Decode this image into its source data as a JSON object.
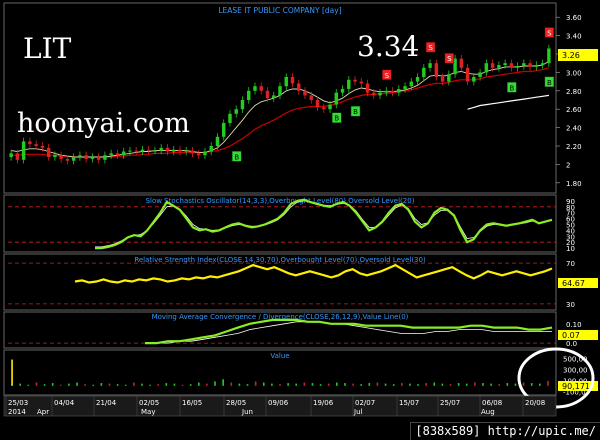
{
  "overlay": {
    "ticker": "LIT",
    "price": "3.34",
    "watermark": "hoonyai.com"
  },
  "footer": "[838x589] http://upic.me/",
  "chart_data": [
    {
      "type": "candlestick",
      "title": "LEASE IT PUBLIC COMPANY [day]",
      "ylim": [
        1.7,
        3.7
      ],
      "yticks": [
        1.8,
        2.0,
        2.2,
        2.4,
        2.6,
        2.8,
        3.0,
        3.2,
        3.4,
        3.6
      ],
      "ytick_labels": [
        "1.80",
        "2",
        "2.20",
        "2.40",
        "2.60",
        "2.80",
        "3.00",
        "3.20",
        "3.40",
        "3.60"
      ],
      "last_price_label": "3.26",
      "close": [
        2.12,
        2.05,
        2.25,
        2.22,
        2.2,
        2.18,
        2.08,
        2.1,
        2.06,
        2.04,
        2.08,
        2.1,
        2.06,
        2.08,
        2.05,
        2.1,
        2.12,
        2.1,
        2.14,
        2.15,
        2.14,
        2.16,
        2.15,
        2.15,
        2.18,
        2.14,
        2.16,
        2.14,
        2.15,
        2.12,
        2.1,
        2.14,
        2.2,
        2.3,
        2.45,
        2.55,
        2.6,
        2.7,
        2.8,
        2.85,
        2.8,
        2.72,
        2.75,
        2.85,
        2.95,
        2.88,
        2.8,
        2.75,
        2.7,
        2.62,
        2.6,
        2.65,
        2.78,
        2.82,
        2.92,
        2.9,
        2.88,
        2.78,
        2.75,
        2.78,
        2.8,
        2.78,
        2.82,
        2.85,
        2.9,
        2.95,
        3.05,
        3.1,
        2.95,
        2.9,
        2.98,
        3.15,
        3.05,
        2.9,
        2.95,
        3.0,
        3.1,
        3.05,
        3.08,
        3.1,
        3.05,
        3.07,
        3.1,
        3.06,
        3.08,
        3.1,
        3.26
      ],
      "buy_signals": [
        36,
        52,
        55,
        80,
        100
      ],
      "sell_signals": [
        60,
        67,
        70,
        88
      ],
      "sma_fast": [
        2.15,
        2.14,
        2.16,
        2.17,
        2.17,
        2.16,
        2.14,
        2.12,
        2.1,
        2.09,
        2.08,
        2.08,
        2.08,
        2.08,
        2.08,
        2.08,
        2.09,
        2.1,
        2.11,
        2.12,
        2.13,
        2.14,
        2.14,
        2.15,
        2.15,
        2.15,
        2.15,
        2.15,
        2.15,
        2.14,
        2.13,
        2.13,
        2.15,
        2.18,
        2.24,
        2.32,
        2.4,
        2.48,
        2.57,
        2.64,
        2.68,
        2.7,
        2.72,
        2.75,
        2.8,
        2.82,
        2.82,
        2.8,
        2.77,
        2.73,
        2.69,
        2.67,
        2.69,
        2.72,
        2.77,
        2.81,
        2.83,
        2.82,
        2.8,
        2.79,
        2.79,
        2.79,
        2.8,
        2.81,
        2.83,
        2.86,
        2.91,
        2.96,
        2.97,
        2.96,
        2.97,
        3.0,
        3.01,
        2.99,
        2.98,
        2.98,
        3.01,
        3.03,
        3.04,
        3.06,
        3.06,
        3.06,
        3.07,
        3.07,
        3.07,
        3.08,
        3.12
      ],
      "sma_slow": [
        2.1,
        2.1,
        2.11,
        2.11,
        2.11,
        2.11,
        2.1,
        2.1,
        2.09,
        2.09,
        2.08,
        2.08,
        2.08,
        2.08,
        2.08,
        2.08,
        2.08,
        2.09,
        2.09,
        2.1,
        2.1,
        2.11,
        2.11,
        2.12,
        2.12,
        2.12,
        2.13,
        2.13,
        2.13,
        2.13,
        2.13,
        2.13,
        2.14,
        2.15,
        2.17,
        2.2,
        2.24,
        2.28,
        2.33,
        2.38,
        2.42,
        2.45,
        2.48,
        2.52,
        2.56,
        2.59,
        2.61,
        2.62,
        2.63,
        2.63,
        2.63,
        2.64,
        2.66,
        2.68,
        2.71,
        2.73,
        2.75,
        2.76,
        2.76,
        2.77,
        2.77,
        2.78,
        2.79,
        2.8,
        2.81,
        2.83,
        2.85,
        2.87,
        2.88,
        2.88,
        2.89,
        2.91,
        2.92,
        2.92,
        2.92,
        2.93,
        2.95,
        2.96,
        2.97,
        2.98,
        2.99,
        3.0,
        3.01,
        3.01,
        3.02,
        3.03,
        3.05
      ],
      "long_ma_start": 73,
      "long_ma": [
        2.6,
        2.62,
        2.64,
        2.65,
        2.66,
        2.67,
        2.68,
        2.69,
        2.7,
        2.71,
        2.72,
        2.73,
        2.74,
        2.75
      ]
    },
    {
      "type": "line",
      "title": "Slow Stochastics Oscillator(14,3,3),Overbought Level(80),Oversold Level(20)",
      "ylim": [
        5,
        95
      ],
      "yticks": [
        10,
        20,
        30,
        40,
        50,
        60,
        70,
        80,
        90
      ],
      "levels": [
        80,
        20
      ],
      "k": [
        10,
        10,
        12,
        15,
        20,
        28,
        32,
        30,
        40,
        55,
        70,
        88,
        82,
        75,
        60,
        45,
        40,
        42,
        38,
        40,
        45,
        50,
        52,
        48,
        45,
        47,
        50,
        55,
        60,
        70,
        85,
        90,
        92,
        88,
        85,
        82,
        80,
        85,
        88,
        82,
        70,
        55,
        40,
        45,
        55,
        70,
        82,
        85,
        75,
        55,
        45,
        52,
        70,
        78,
        75,
        65,
        40,
        20,
        25,
        40,
        50,
        52,
        50,
        48,
        50,
        52,
        55,
        58,
        52,
        55,
        58
      ],
      "d": [
        12,
        12,
        14,
        17,
        22,
        28,
        31,
        33,
        40,
        52,
        66,
        80,
        82,
        76,
        64,
        50,
        43,
        42,
        40,
        41,
        44,
        48,
        50,
        49,
        47,
        47,
        49,
        53,
        58,
        67,
        80,
        88,
        90,
        88,
        86,
        83,
        82,
        84,
        86,
        83,
        73,
        58,
        45,
        45,
        53,
        66,
        78,
        83,
        77,
        60,
        50,
        53,
        66,
        74,
        74,
        67,
        45,
        26,
        28,
        38,
        47,
        50,
        50,
        49,
        50,
        51,
        53,
        56,
        53,
        55,
        57
      ]
    },
    {
      "type": "line",
      "title": "Relative Strength Index(CLOSE,14,30,70),Overbought Level(70),Oversold Level(30)",
      "ylim": [
        25,
        75
      ],
      "yticks": [
        30,
        50,
        70
      ],
      "levels": [
        70,
        30
      ],
      "last_value_label": "64.67",
      "values": [
        52,
        53,
        51,
        52,
        54,
        52,
        51,
        53,
        52,
        54,
        53,
        55,
        54,
        52,
        53,
        55,
        54,
        56,
        55,
        57,
        56,
        58,
        60,
        62,
        65,
        68,
        66,
        64,
        66,
        63,
        60,
        58,
        60,
        62,
        60,
        58,
        56,
        58,
        62,
        64,
        60,
        58,
        60,
        62,
        65,
        68,
        64,
        60,
        56,
        58,
        60,
        62,
        64,
        66,
        62,
        58,
        55,
        58,
        62,
        60,
        58,
        60,
        62,
        60,
        58,
        60,
        62,
        64.67
      ]
    },
    {
      "type": "line",
      "title": "Moving Average Convergence / Divergence(CLOSE,26,12,9),Value Line(0)",
      "ylim": [
        -0.02,
        0.14
      ],
      "yticks": [
        0.1,
        0.0
      ],
      "ytick_labels": [
        "0.10",
        "0.0"
      ],
      "level": 0,
      "last_value_label": "0.07",
      "macd": [
        0.0,
        0.0,
        0.01,
        0.01,
        0.02,
        0.03,
        0.04,
        0.06,
        0.08,
        0.1,
        0.11,
        0.12,
        0.12,
        0.12,
        0.11,
        0.11,
        0.1,
        0.1,
        0.1,
        0.09,
        0.09,
        0.09,
        0.09,
        0.08,
        0.08,
        0.08,
        0.08,
        0.08,
        0.09,
        0.09,
        0.08,
        0.08,
        0.08,
        0.07,
        0.07,
        0.08
      ],
      "signal": [
        0.0,
        0.0,
        0.0,
        0.01,
        0.01,
        0.02,
        0.03,
        0.04,
        0.05,
        0.07,
        0.08,
        0.09,
        0.1,
        0.11,
        0.11,
        0.11,
        0.1,
        0.1,
        0.09,
        0.08,
        0.07,
        0.06,
        0.05,
        0.05,
        0.05,
        0.06,
        0.06,
        0.07,
        0.07,
        0.07,
        0.06,
        0.06,
        0.06,
        0.06,
        0.06,
        0.06
      ]
    },
    {
      "type": "bar",
      "title": "Value",
      "ylim": [
        -150000,
        600000
      ],
      "yticks": [
        500000,
        300000,
        100000,
        -100000
      ],
      "ytick_labels": [
        "500,00",
        "300,00",
        "100,00",
        "-100,0"
      ],
      "last_value_label": "90,171",
      "values": [
        480000,
        40000,
        20000,
        60000,
        30000,
        50000,
        20000,
        40000,
        60000,
        30000,
        20000,
        50000,
        40000,
        30000,
        20000,
        60000,
        40000,
        20000,
        30000,
        50000,
        40000,
        20000,
        30000,
        60000,
        40000,
        80000,
        120000,
        60000,
        40000,
        30000,
        80000,
        60000,
        40000,
        30000,
        50000,
        40000,
        60000,
        50000,
        30000,
        40000,
        60000,
        50000,
        40000,
        30000,
        50000,
        60000,
        40000,
        30000,
        50000,
        40000,
        30000,
        50000,
        60000,
        40000,
        30000,
        50000,
        40000,
        60000,
        50000,
        40000,
        30000,
        50000,
        40000,
        60000,
        50000,
        40000,
        90171
      ]
    }
  ],
  "x_axis": {
    "date_ticks": [
      "25/03",
      "04/04",
      "21/04",
      "02/05",
      "16/05",
      "28/05",
      "09/06",
      "19/06",
      "02/07",
      "15/07",
      "25/07",
      "06/08",
      "20/08"
    ],
    "period_labels": [
      "2014",
      "Apr",
      "May",
      "Jun",
      "Jul",
      "Aug"
    ]
  }
}
